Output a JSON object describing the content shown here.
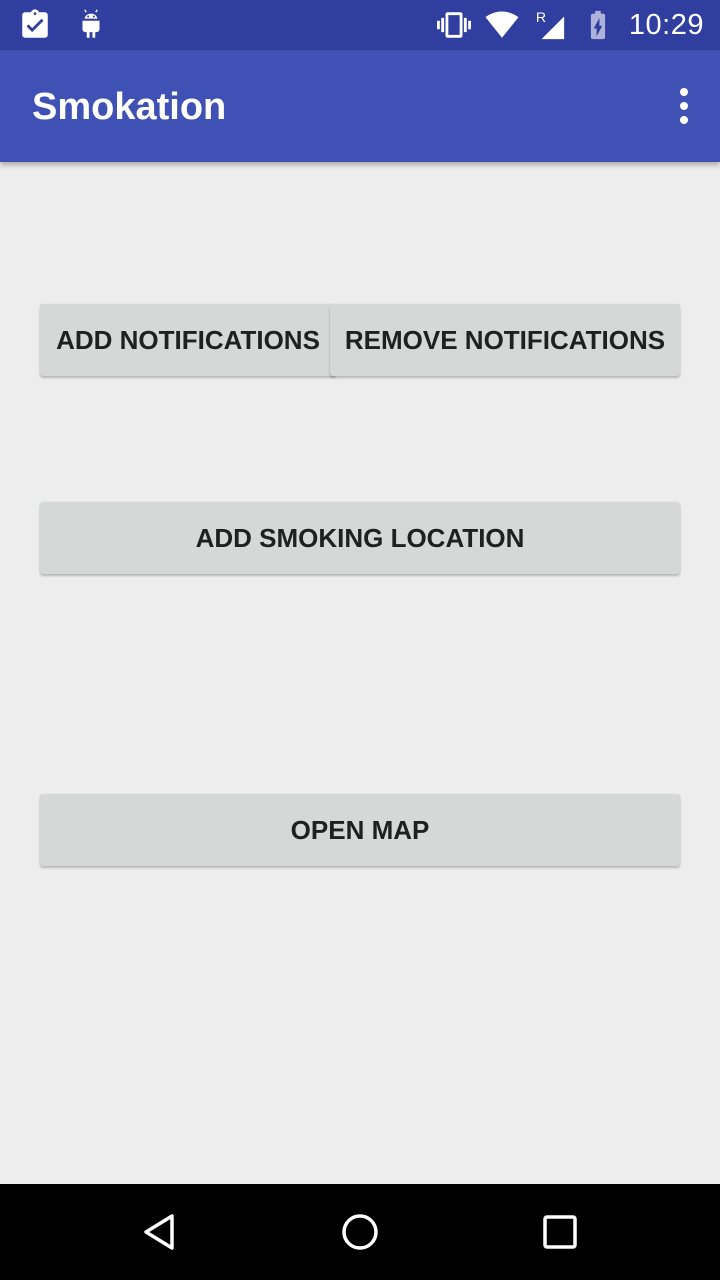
{
  "status_bar": {
    "time": "10:29",
    "icons": [
      "clipboard-check-icon",
      "android-icon",
      "vibrate-icon",
      "wifi-icon",
      "signal-roaming-icon",
      "battery-charging-icon"
    ],
    "roaming_label": "R"
  },
  "app_bar": {
    "title": "Smokation",
    "menu_icon": "overflow-menu-icon"
  },
  "main": {
    "add_notifications_label": "ADD NOTIFICATIONS",
    "remove_notifications_label": "REMOVE NOTIFICATIONS",
    "add_smoking_location_label": "ADD SMOKING LOCATION",
    "open_map_label": "OPEN MAP"
  },
  "nav_bar": {
    "icons": [
      "back-icon",
      "home-icon",
      "recents-icon"
    ]
  },
  "colors": {
    "status_bar": "#303f9f",
    "app_bar": "#3f51b5",
    "background": "#ededed",
    "button": "#d6d7d7"
  }
}
